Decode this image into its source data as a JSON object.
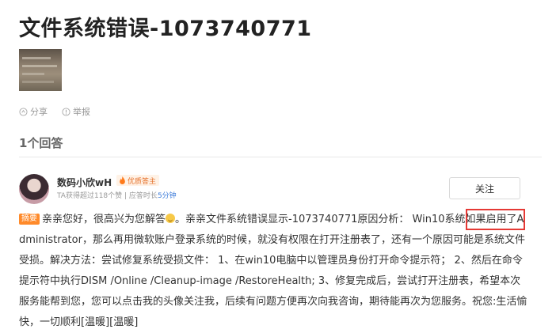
{
  "question": {
    "title": "文件系统错误-1073740771"
  },
  "actions": {
    "share_label": "分享",
    "report_label": "举报"
  },
  "answers": {
    "count_label": "1个回答"
  },
  "answer": {
    "user_name": "数码小欣wH",
    "badge_label": "优质答主",
    "meta_prefix": "TA获得超过",
    "meta_likes": "118个赞",
    "meta_sep": " | ",
    "meta_response_prefix": "应答时长",
    "meta_response_time": "5分钟",
    "follow_label": "关注",
    "summary_tag": "摘要",
    "text_part1": "亲亲您好，很高兴为您解答",
    "text_part2": "。亲亲文件系统错误显示-1073740771原因分析：  Win10系统如果启用了Administrator，那么再用微软账户登录系统的时候，就没有权限在打开注册表了，还有一个原因可能是系统文件受损。解决方法：尝试修复系统受损文件：   1、在win10电脑中以管理员身份打开命令提示符；  2、然后在命令提示符中执行DISM /Online /Cleanup-image /RestoreHealth;   3、修复完成后，尝试打开注册表，希望本次服务能帮到您，您可以点击我的头像关注我，后续有问题方便再次向我咨询，期待能再次为您服务。祝您:生活愉快，一切顺利[温暖][温暖]"
  },
  "colors": {
    "badge": "#e5702a",
    "summary_tag": "#ff8a2a",
    "link": "#3c7bd9",
    "highlight": "#e53935"
  },
  "icons": {
    "share": "share-icon",
    "report": "warning-icon",
    "badge": "flame-icon",
    "emoji": "smile-emoji"
  }
}
